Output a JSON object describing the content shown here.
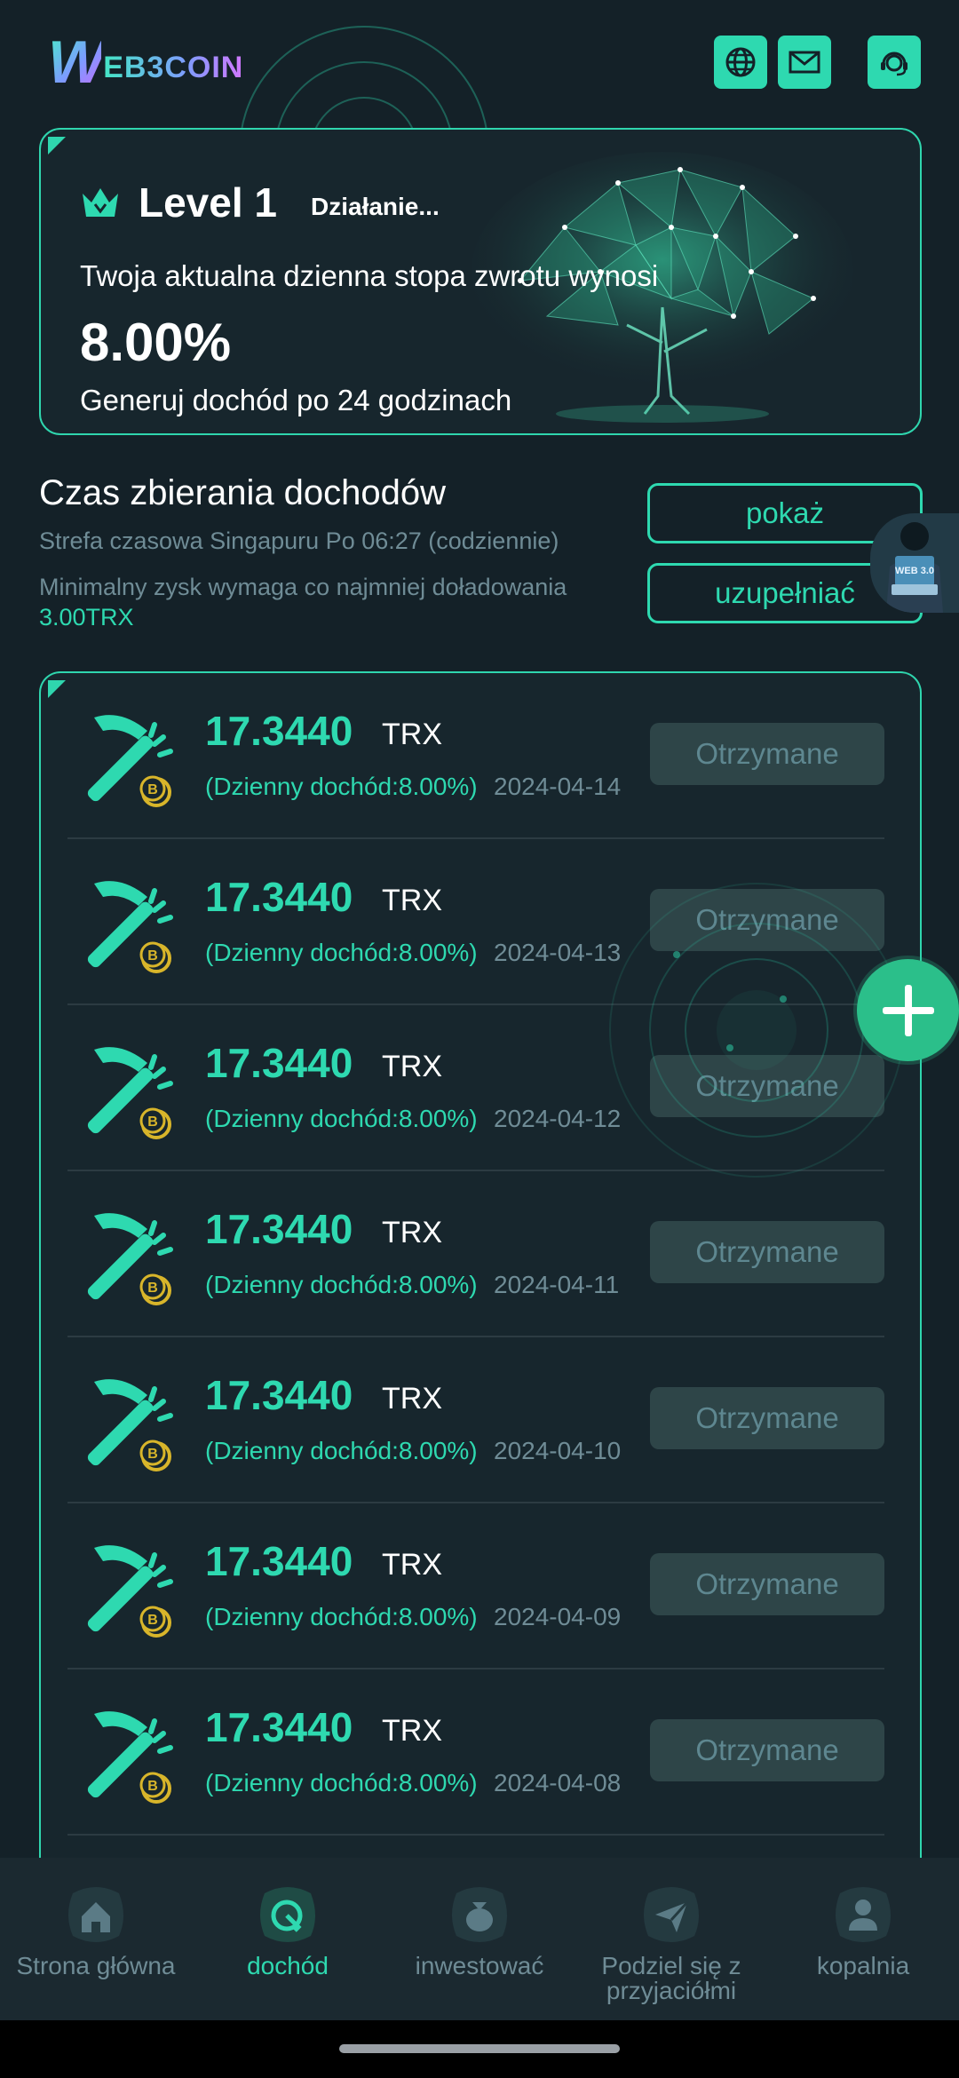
{
  "header": {
    "logo_w": "W",
    "logo_text": "EB3COIN",
    "icons": [
      "globe-icon",
      "mail-icon",
      "support-agent-icon"
    ]
  },
  "level_card": {
    "title": "Level 1",
    "status": "Działanie...",
    "rate_label": "Twoja aktualna dzienna stopa zwrotu wynosi",
    "rate_value": "8.00%",
    "note": "Generuj dochód po 24 godzinach"
  },
  "income_time": {
    "title": "Czas zbierania dochodów",
    "timezone": "Strefa czasowa Singapuru Po 06:27 (codziennie)",
    "min_label": "Minimalny zysk wymaga co najmniej doładowania",
    "min_amount": "3.00TRX",
    "show_button": "pokaż",
    "topup_button": "uzupełniać"
  },
  "records": [
    {
      "amount": "17.3440",
      "unit": "TRX",
      "rate": "(Dzienny dochód:8.00%)",
      "date": "2024-04-14",
      "status": "Otrzymane"
    },
    {
      "amount": "17.3440",
      "unit": "TRX",
      "rate": "(Dzienny dochód:8.00%)",
      "date": "2024-04-13",
      "status": "Otrzymane"
    },
    {
      "amount": "17.3440",
      "unit": "TRX",
      "rate": "(Dzienny dochód:8.00%)",
      "date": "2024-04-12",
      "status": "Otrzymane"
    },
    {
      "amount": "17.3440",
      "unit": "TRX",
      "rate": "(Dzienny dochód:8.00%)",
      "date": "2024-04-11",
      "status": "Otrzymane"
    },
    {
      "amount": "17.3440",
      "unit": "TRX",
      "rate": "(Dzienny dochód:8.00%)",
      "date": "2024-04-10",
      "status": "Otrzymane"
    },
    {
      "amount": "17.3440",
      "unit": "TRX",
      "rate": "(Dzienny dochód:8.00%)",
      "date": "2024-04-09",
      "status": "Otrzymane"
    },
    {
      "amount": "17.3440",
      "unit": "TRX",
      "rate": "(Dzienny dochód:8.00%)",
      "date": "2024-04-08",
      "status": "Otrzymane"
    }
  ],
  "bottom_nav": [
    {
      "label": "Strona główna",
      "icon": "home-icon",
      "active": false
    },
    {
      "label": "dochód",
      "icon": "income-icon",
      "active": true
    },
    {
      "label": "inwestować",
      "icon": "money-bag-icon",
      "active": false
    },
    {
      "label": "Podziel się z przyjaciółmi",
      "icon": "share-paper-plane-icon",
      "active": false
    },
    {
      "label": "kopalnia",
      "icon": "user-icon",
      "active": false
    }
  ],
  "colors": {
    "background": "#142128",
    "accent": "#2ed9b0",
    "muted_text": "#6f8c96",
    "received_button": "#2e4548",
    "fab": "#2bbf8a"
  }
}
